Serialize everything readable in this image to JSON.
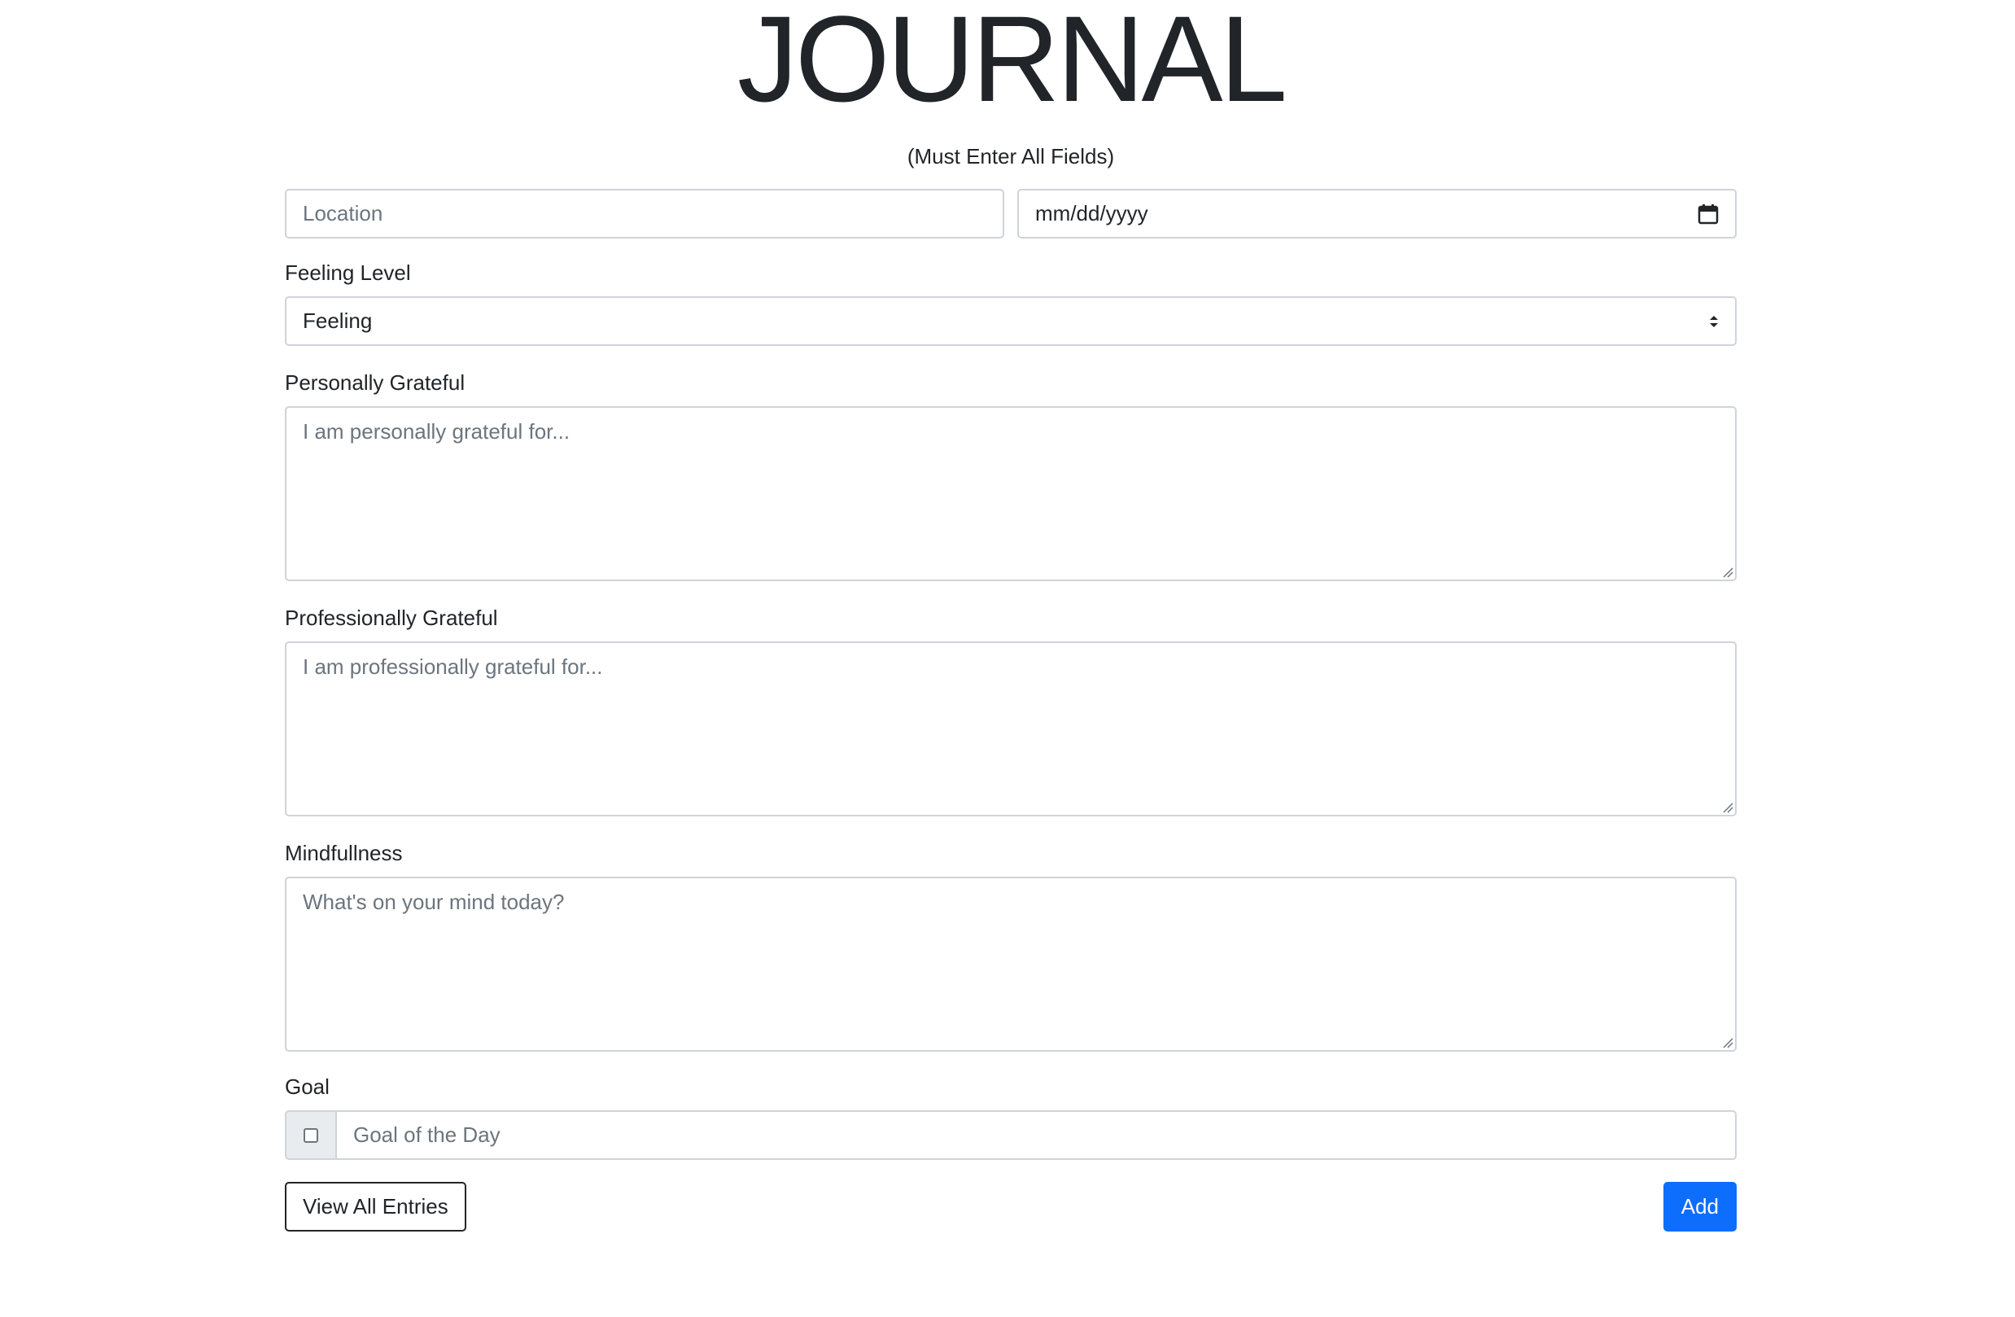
{
  "header": {
    "title": "JOURNAL",
    "subtitle": "(Must Enter All Fields)"
  },
  "form": {
    "location": {
      "placeholder": "Location"
    },
    "date": {
      "placeholder": "mm/dd/yyyy",
      "icon": "calendar-icon"
    },
    "feeling": {
      "label": "Feeling Level",
      "selected": "Feeling"
    },
    "personal": {
      "label": "Personally Grateful",
      "placeholder": "I am personally grateful for..."
    },
    "professional": {
      "label": "Professionally Grateful",
      "placeholder": "I am professionally grateful for..."
    },
    "mindfulness": {
      "label": "Mindfullness",
      "placeholder": "What's on your mind today?"
    },
    "goal": {
      "label": "Goal",
      "placeholder": "Goal of the Day",
      "checked": false
    }
  },
  "actions": {
    "view_all_label": "View All Entries",
    "add_label": "Add"
  },
  "colors": {
    "primary": "#0d6efd",
    "border": "#ced4da",
    "text": "#212529",
    "placeholder": "#6c757d",
    "addon_bg": "#e9ecef"
  }
}
